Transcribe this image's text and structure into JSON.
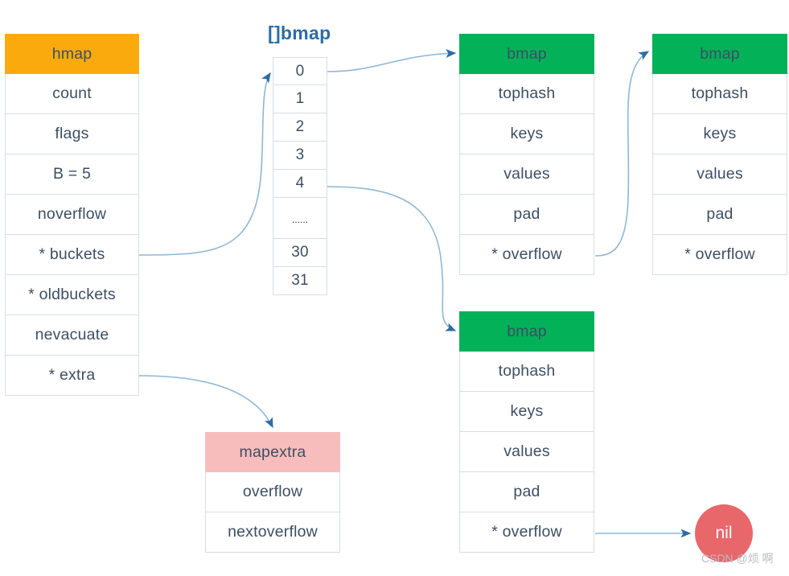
{
  "diagram": {
    "title_bmap_array": "[]bmap",
    "watermark": "CSDN @烦 啊",
    "colors": {
      "hmap_header": "#fbaa0d",
      "bmap_header": "#03b159",
      "mapextra_header": "#f7bdbc",
      "nil_node": "#e8676b",
      "connector": "#8fb7d4",
      "arrowhead": "#2e6ca4",
      "text": "#3d4f63",
      "array_title": "#2e6ca4",
      "cell_border": "#d8dde3"
    }
  },
  "hmap": {
    "header": "hmap",
    "fields": [
      "count",
      "flags",
      "B = 5",
      "noverflow",
      "* buckets",
      "* oldbuckets",
      "nevacuate",
      "* extra"
    ]
  },
  "bmap_array": {
    "title": "[]bmap",
    "slots": [
      "0",
      "1",
      "2",
      "3",
      "4",
      "......",
      "30",
      "31"
    ]
  },
  "bmap_1": {
    "header": "bmap",
    "fields": [
      "tophash",
      "keys",
      "values",
      "pad",
      "* overflow"
    ]
  },
  "bmap_2": {
    "header": "bmap",
    "fields": [
      "tophash",
      "keys",
      "values",
      "pad",
      "* overflow"
    ]
  },
  "bmap_3": {
    "header": "bmap",
    "fields": [
      "tophash",
      "keys",
      "values",
      "pad",
      "* overflow"
    ]
  },
  "mapextra": {
    "header": "mapextra",
    "fields": [
      "overflow",
      "nextoverflow"
    ]
  },
  "nil_node": {
    "label": "nil"
  }
}
